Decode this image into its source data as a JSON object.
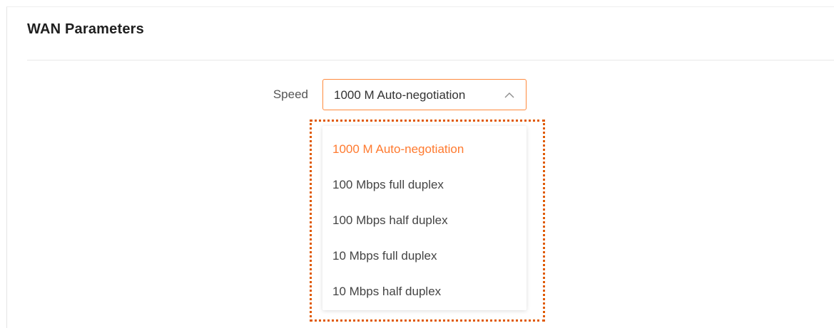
{
  "section": {
    "title": "WAN Parameters"
  },
  "speed": {
    "label": "Speed",
    "selected_value": "1000 M Auto-negotiation",
    "options": [
      {
        "label": "1000 M Auto-negotiation",
        "selected": true
      },
      {
        "label": "100 Mbps full duplex",
        "selected": false
      },
      {
        "label": "100 Mbps half duplex",
        "selected": false
      },
      {
        "label": "10 Mbps full duplex",
        "selected": false
      },
      {
        "label": "10 Mbps half duplex",
        "selected": false
      }
    ]
  },
  "colors": {
    "accent": "#ff7a2f",
    "select_border": "#ff8a3d",
    "highlight_outline": "#e05a00"
  },
  "icons": {
    "select_arrow": "chevron-up-icon"
  }
}
